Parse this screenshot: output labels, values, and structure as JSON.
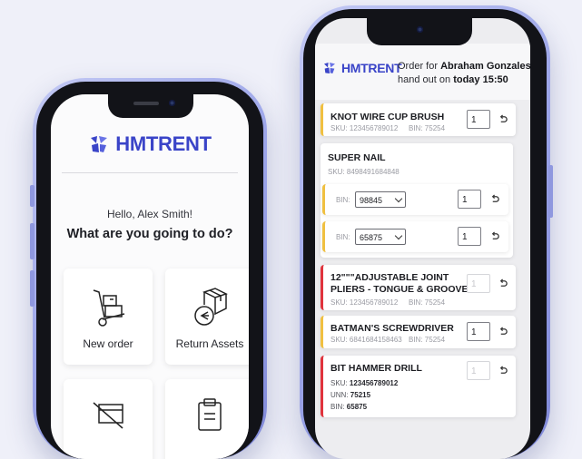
{
  "brand": {
    "name": "HMTRENT",
    "color": "#3a44c8"
  },
  "home": {
    "greeting": "Hello, Alex Smith!",
    "question": "What are you going to do?",
    "tiles": [
      {
        "label": "New order",
        "icon": "hand-truck-icon"
      },
      {
        "label": "Return Assets",
        "icon": "box-return-icon"
      },
      {
        "label": "",
        "icon": "broken-item-icon"
      },
      {
        "label": "",
        "icon": "clipboard-icon"
      }
    ]
  },
  "order": {
    "prefix": "Order for",
    "customer": "Abraham Gonzales",
    "handout_prefix": "hand out on",
    "handout_time": "today 15:50",
    "sku_label": "SKU:",
    "bin_label": "BIN:",
    "unn_label": "UNN:",
    "items": [
      {
        "name": "KNOT WIRE CUP BRUSH",
        "sku": "123456789012",
        "bin": "75254",
        "qty": "1",
        "status_color": "#f0c040"
      },
      {
        "name": "SUPER NAIL",
        "sku": "8498491684848",
        "bins": [
          {
            "bin": "98845",
            "qty": "1"
          },
          {
            "bin": "65875",
            "qty": "1"
          }
        ],
        "status_color": "#f0c040"
      },
      {
        "name": "12\"\"\"ADJUSTABLE JOINT PLIERS - TONGUE & GROOVE",
        "sku": "123456789012",
        "bin": "75254",
        "qty": "1",
        "status_color": "#e0333c"
      },
      {
        "name": "BATMAN'S SCREWDRIVER",
        "sku": "6841684158463",
        "bin": "75254",
        "qty": "1",
        "status_color": "#f0c040"
      },
      {
        "name": "BIT HAMMER DRILL",
        "sku": "123456789012",
        "unn": "75215",
        "bin": "65875",
        "qty": "1",
        "status_color": "#e0333c"
      }
    ]
  }
}
